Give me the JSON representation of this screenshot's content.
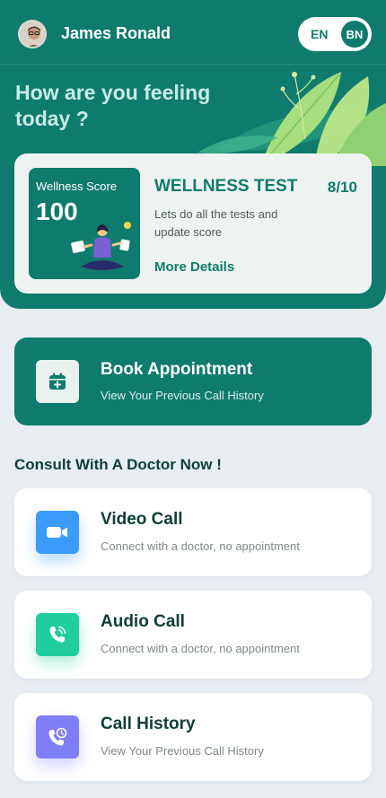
{
  "user": {
    "name": "James Ronald"
  },
  "language": {
    "en_label": "EN",
    "bn_label": "BN"
  },
  "greeting": "How are you feeling today ?",
  "wellness": {
    "score_label": "Wellness Score",
    "score_value": "100",
    "title": "WELLNESS TEST",
    "progress": "8/10",
    "description": "Lets do all the tests and update score",
    "more_link": "More Details"
  },
  "book": {
    "title": "Book Appointment",
    "subtitle": "View Your Previous Call History",
    "icon": "calendar-plus-icon"
  },
  "consult": {
    "section_title": "Consult With A Doctor Now !",
    "items": [
      {
        "title": "Video Call",
        "subtitle": "Connect with a doctor, no appointment",
        "icon": "video-camera-icon",
        "color": "#3a9bfb"
      },
      {
        "title": "Audio Call",
        "subtitle": "Connect with a doctor, no appointment",
        "icon": "phone-icon",
        "color": "#1fce9c"
      },
      {
        "title": "Call History",
        "subtitle": "View Your Previous Call History",
        "icon": "phone-history-icon",
        "color": "#7f7ef6"
      }
    ]
  },
  "colors": {
    "primary": "#0f7b6c",
    "background": "#e8edf2",
    "greeting": "#c6ece4"
  }
}
